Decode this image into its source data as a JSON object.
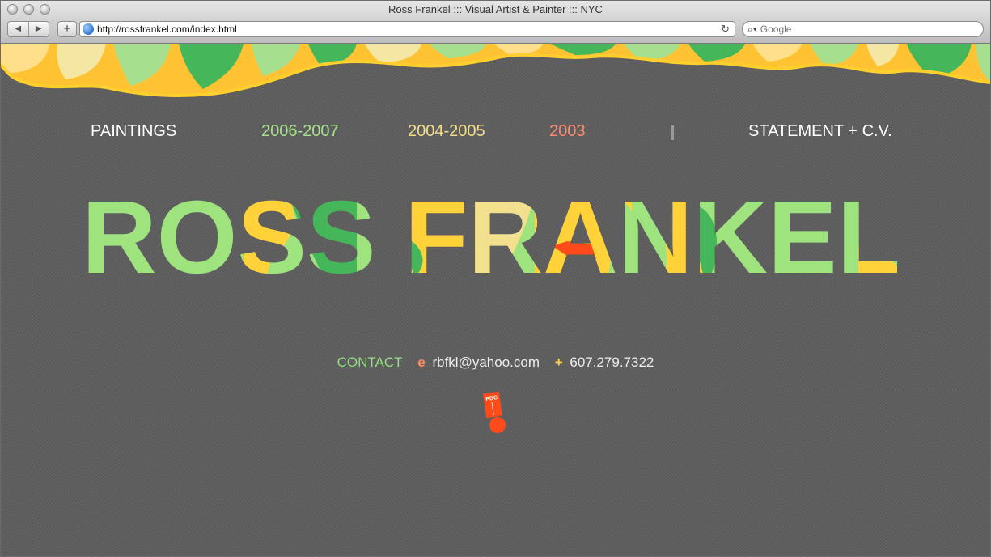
{
  "window": {
    "title": "Ross Frankel ::: Visual Artist & Painter ::: NYC",
    "back_label": "◀",
    "forward_label": "▶",
    "add_label": "+",
    "url": "http://rossfrankel.com/index.html",
    "search_placeholder": "Google"
  },
  "nav": {
    "paintings": "PAINTINGS",
    "years": [
      "2006-2007",
      "2004-2005",
      "2003"
    ],
    "statement": "STATEMENT + C.V."
  },
  "logo": {
    "text": "ROSS FRANKEL"
  },
  "contact": {
    "label": "CONTACT",
    "email_prefix": "e",
    "email": "rbfkl@yahoo.com",
    "phone_prefix": "+",
    "phone": "607.279.7322"
  },
  "badge": {
    "text": "PDG"
  },
  "colors": {
    "nav_paintings": "#ffffff",
    "year_2006": "#a6e08e",
    "year_2004": "#f3dc8a",
    "year_2003": "#ff8b6e",
    "statement": "#ffffff",
    "logo_green_light": "#9fe37f",
    "logo_green_dark": "#45b65a",
    "logo_yellow": "#ffd23a",
    "logo_cream": "#f3e08f",
    "logo_orange": "#ff4a1a"
  }
}
